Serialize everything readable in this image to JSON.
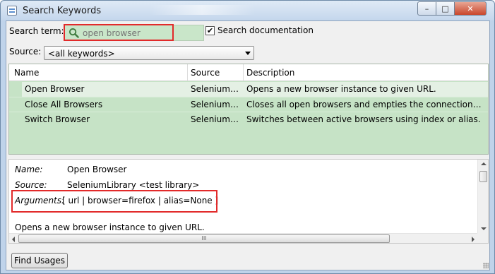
{
  "window": {
    "title": "Search Keywords",
    "minimize_glyph": "–",
    "maximize_glyph": "□",
    "close_glyph": "✕"
  },
  "search": {
    "label": "Search term:",
    "value": "",
    "placeholder": "open browser",
    "search_docs_label": "Search documentation",
    "search_docs_checked": true,
    "check_glyph": "✔"
  },
  "source": {
    "label": "Source:",
    "selected": "<all keywords>"
  },
  "table": {
    "headers": [
      "Name",
      "Source",
      "Description"
    ],
    "rows": [
      {
        "name": "Open Browser",
        "source": "SeleniumL...",
        "description": "Opens a new browser instance to given URL."
      },
      {
        "name": "Close All Browsers",
        "source": "SeleniumL...",
        "description": "Closes all open browsers and empties the connection c..."
      },
      {
        "name": "Switch Browser",
        "source": "SeleniumL...",
        "description": "Switches between active browsers using index or alias."
      }
    ]
  },
  "details": {
    "name_key": "Name:",
    "name_value": "Open Browser",
    "source_key": "Source:",
    "source_value": "SeleniumLibrary <test library>",
    "arguments_key": "Arguments:",
    "arguments_value": "[ url | browser=firefox | alias=None ]",
    "doc_text": "Opens a new browser instance to given URL.",
    "hscroll_grip": "III"
  },
  "footer": {
    "find_usages_label": "Find Usages"
  },
  "colors": {
    "highlight_green": "#c6e3c6",
    "annotation_red": "#e22a2a",
    "titlebar": "#c4d6ec"
  }
}
